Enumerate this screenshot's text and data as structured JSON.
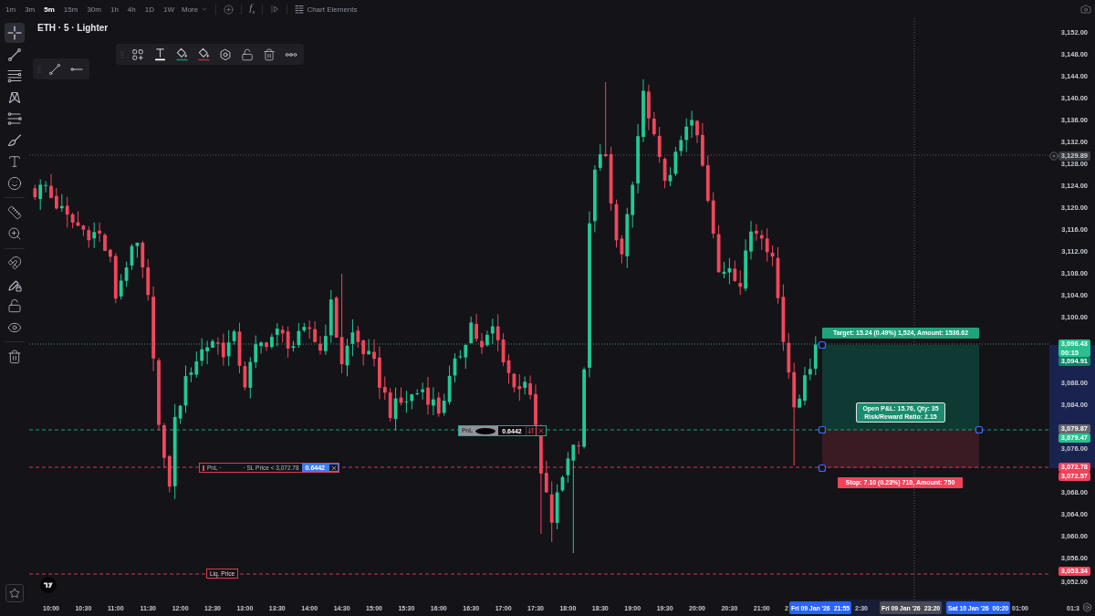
{
  "toolbar": {
    "timeframes": [
      {
        "label": "1m",
        "selected": false
      },
      {
        "label": "3m",
        "selected": false
      },
      {
        "label": "5m",
        "selected": true
      },
      {
        "label": "15m",
        "selected": false
      },
      {
        "label": "30m",
        "selected": false
      },
      {
        "label": "1h",
        "selected": false
      },
      {
        "label": "4h",
        "selected": false
      },
      {
        "label": "1D",
        "selected": false
      },
      {
        "label": "1W",
        "selected": false
      }
    ],
    "more": "More",
    "indicators": "f$_{x}$",
    "chart_elements": "Chart Elements"
  },
  "drawing_tools": [
    {
      "selected": true
    },
    {
      "selected": false
    },
    {
      "selected": false
    },
    {
      "selected": false
    },
    {
      "selected": false
    },
    {
      "selected": false
    },
    {
      "selected": false
    },
    {
      "selected": false
    },
    {
      "selected": false
    },
    {
      "selected": false
    },
    {
      "selected": false
    },
    {
      "selected": false
    },
    {
      "selected": false
    },
    {
      "selected": false
    },
    {
      "selected": false
    }
  ],
  "legend": "ETH · 5 · Lighter",
  "position_tool": {
    "target": "Target: 15.24 (0.49%) 1,524, Amount: 1536.62",
    "open_pnl": "Open P&L: 15.76, Qty: 35",
    "risk_reward": "Risk/Reward Ratio: 2.15",
    "stop": "Stop: 7.10 (0.23%) 710, Amount: 750"
  },
  "order_labels": [
    {
      "kind": "position",
      "label": "PnL",
      "value": "0.6442"
    },
    {
      "kind": "stop_loss",
      "label": "PnL ·",
      "detail": "· SL Price < 3,072.78",
      "value": "0.6442"
    },
    {
      "kind": "liquidation",
      "label": "Liq. Price"
    }
  ],
  "price_axis": {
    "labels": [
      "3,152.00",
      "3,148.00",
      "3,144.00",
      "3,140.00",
      "3,136.00",
      "3,132.00",
      "3,128.00",
      "3,124.00",
      "3,120.00",
      "3,116.00",
      "3,112.00",
      "3,108.00",
      "3,104.00",
      "3,100.00",
      "3,088.00",
      "3,084.00",
      "3,076.00",
      "3,068.00",
      "3,064.00",
      "3,060.00",
      "3,056.00",
      "3,052.00"
    ],
    "markers": [
      {
        "kind": "alert",
        "price": "3,129.89",
        "color": "#3a3a42"
      },
      {
        "kind": "last",
        "price": "3,096.43",
        "countdown": "00:15",
        "color": "#26c18e"
      },
      {
        "kind": "level",
        "price": "3,094.91",
        "color": "#0e8466"
      },
      {
        "kind": "level",
        "price": "3,079.87",
        "color": "#66666e"
      },
      {
        "kind": "level",
        "price": "3,079.47",
        "color": "#26c18e"
      },
      {
        "kind": "level",
        "price": "3,072.78",
        "color": "#f0435a"
      },
      {
        "kind": "level",
        "price": "3,072.57",
        "color": "#f0435a"
      },
      {
        "kind": "level",
        "price": "3,053.34",
        "color": "#f0435a"
      }
    ]
  },
  "time_axis": {
    "labels": [
      "10:00",
      "10:30",
      "11:00",
      "11:30",
      "12:00",
      "12:30",
      "13:00",
      "13:30",
      "14:00",
      "14:30",
      "15:00",
      "15:30",
      "16:00",
      "16:30",
      "17:00",
      "17:30",
      "18:00",
      "18:30",
      "19:00",
      "19:30",
      "20:00",
      "20:30",
      "21:00",
      "2",
      "2:30",
      "01:00",
      "01:3"
    ],
    "markers": [
      {
        "date": "Fri 09 Jan '26",
        "time": "21:55",
        "color": "#2962ff"
      },
      {
        "date": "Fri 09 Jan '26",
        "time": "23:20",
        "color": "#4a4a52"
      },
      {
        "date": "Sat 10 Jan '26",
        "time": "00:20",
        "color": "#2962ff"
      }
    ]
  }
}
